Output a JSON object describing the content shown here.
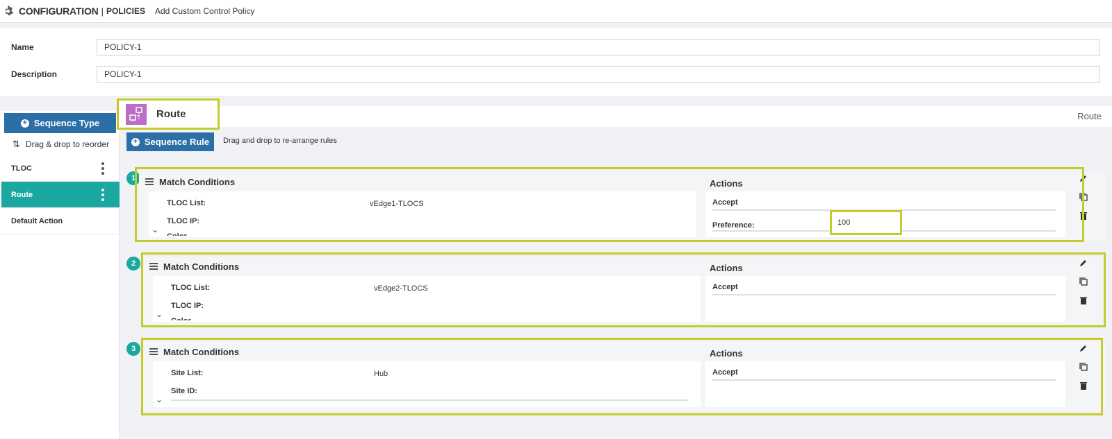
{
  "header": {
    "title": "CONFIGURATION",
    "separator": "|",
    "section": "POLICIES",
    "page": "Add Custom Control Policy"
  },
  "form": {
    "name_label": "Name",
    "name_value": "POLICY-1",
    "description_label": "Description",
    "description_value": "POLICY-1"
  },
  "sidebar": {
    "sequence_type_button": "Sequence Type",
    "drag_hint": "Drag & drop to reorder",
    "items": [
      {
        "label": "TLOC",
        "active": false
      },
      {
        "label": "Route",
        "active": true
      },
      {
        "label": "Default Action",
        "active": false
      }
    ]
  },
  "main": {
    "section_title": "Route",
    "section_right_label": "Route",
    "sequence_rule_button": "Sequence Rule",
    "rearrange_hint": "Drag and drop to re-arrange rules",
    "sequences": [
      {
        "number": "1",
        "match_title": "Match Conditions",
        "actions_title": "Actions",
        "conditions": [
          {
            "label": "TLOC List:",
            "value": "vEdge1-TLOCS"
          },
          {
            "label": "TLOC IP:",
            "value": ""
          }
        ],
        "actions": [
          {
            "label": "Accept",
            "value": ""
          },
          {
            "label": "Preference:",
            "value": "100"
          }
        ]
      },
      {
        "number": "2",
        "match_title": "Match Conditions",
        "actions_title": "Actions",
        "conditions": [
          {
            "label": "TLOC List:",
            "value": "vEdge2-TLOCS"
          },
          {
            "label": "TLOC IP:",
            "value": ""
          }
        ],
        "actions": [
          {
            "label": "Accept",
            "value": ""
          }
        ]
      },
      {
        "number": "3",
        "match_title": "Match Conditions",
        "actions_title": "Actions",
        "conditions": [
          {
            "label": "Site List:",
            "value": "Hub"
          },
          {
            "label": "Site ID:",
            "value": ""
          }
        ],
        "actions": [
          {
            "label": "Accept",
            "value": ""
          }
        ]
      }
    ]
  },
  "colors": {
    "primary_button": "#2c6fa6",
    "active_teal": "#1aa8a0",
    "highlight_outline": "#c4cc2a",
    "route_icon": "#b96ec7"
  },
  "icons": [
    "gear-icon",
    "plus-circle-icon",
    "reorder-arrows-icon",
    "kebab-icon",
    "route-icon",
    "hamburger-icon",
    "chevron-down-icon",
    "edit-icon",
    "copy-icon",
    "delete-icon"
  ]
}
